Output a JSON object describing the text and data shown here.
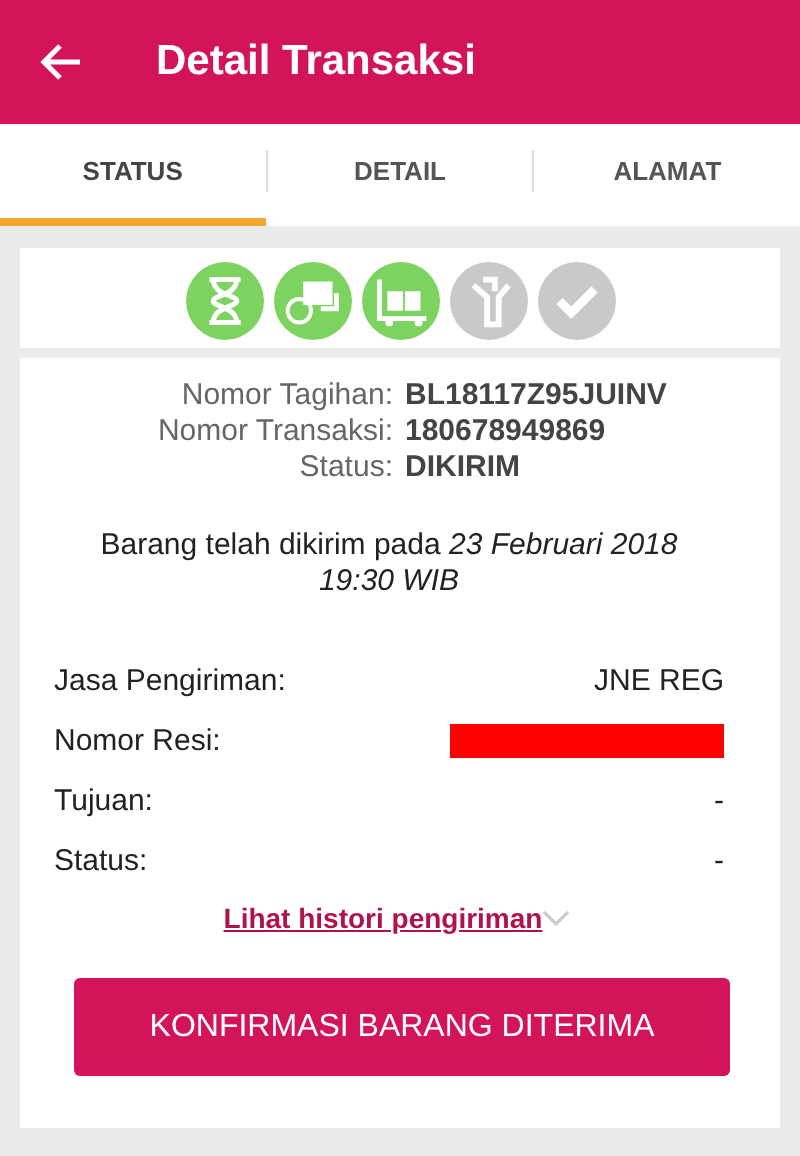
{
  "header": {
    "title": "Detail Transaksi"
  },
  "tabs": [
    {
      "label": "STATUS",
      "selected": true
    },
    {
      "label": "DETAIL",
      "selected": false
    },
    {
      "label": "ALAMAT",
      "selected": false
    }
  ],
  "steps": [
    {
      "kind": "hourglass",
      "done": true
    },
    {
      "kind": "payment",
      "done": true
    },
    {
      "kind": "truck",
      "done": true
    },
    {
      "kind": "box",
      "done": false
    },
    {
      "kind": "check",
      "done": false
    }
  ],
  "summary": [
    {
      "label": "Nomor Tagihan:",
      "value": "BL18117Z95JUINV"
    },
    {
      "label": "Nomor Transaksi:",
      "value": "180678949869"
    },
    {
      "label": "Status:",
      "value": "DIKIRIM"
    }
  ],
  "message": "Barang telah dikirim pada *23 Februari 2018 19:30 WIB*",
  "shipping": [
    {
      "label": "Jasa Pengiriman:",
      "value": "JNE REG",
      "redacted": false
    },
    {
      "label": "Nomor Resi:",
      "redacted": true
    },
    {
      "label": "Tujuan:",
      "value": "-",
      "redacted": false
    },
    {
      "label": "Status:",
      "value": "-",
      "redacted": false
    }
  ],
  "history_link": "Lihat histori pengiriman",
  "confirm_button": "KONFIRMASI BARANG DITERIMA"
}
